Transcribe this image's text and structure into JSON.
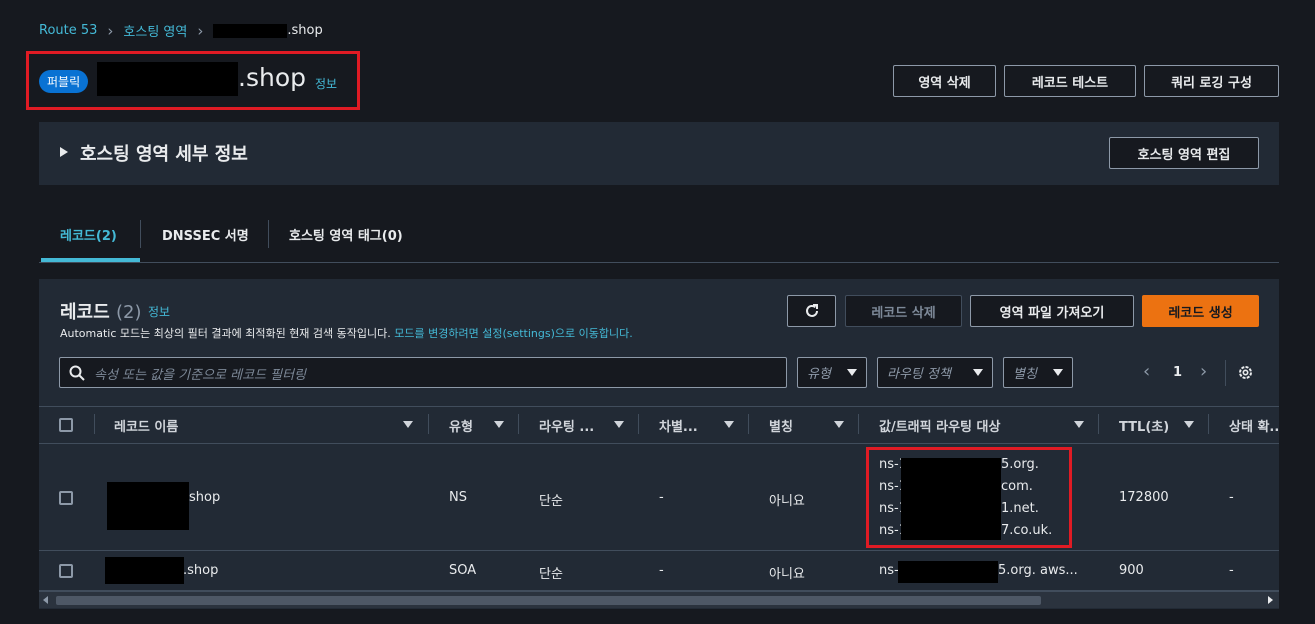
{
  "breadcrumb": {
    "root": "Route 53",
    "hosted_zones": "호스팅 영역",
    "current": ".shop"
  },
  "header": {
    "badge": "퍼블릭",
    "domain_suffix": ".shop",
    "info": "정보"
  },
  "header_buttons": {
    "delete_zone": "영역 삭제",
    "test_record": "레코드 테스트",
    "query_logging": "쿼리 로깅 구성"
  },
  "hosted_zone_details": {
    "title": "호스팅 영역 세부 정보",
    "edit_button": "호스팅 영역 편집"
  },
  "tabs": [
    {
      "label": "레코드(2)"
    },
    {
      "label": "DNSSEC 서명"
    },
    {
      "label": "호스팅 영역 태그(0)"
    }
  ],
  "records": {
    "title": "레코드",
    "count": "(2)",
    "info": "정보",
    "description_prefix": "Automatic 모드는 최상의 필터 결과에 최적화된 현재 검색 동작입니다.",
    "description_link": "모드를 변경하려면 설정(settings)으로 이동합니다.",
    "delete_button": "레코드 삭제",
    "import_button": "영역 파일 가져오기",
    "create_button": "레코드 생성",
    "search_placeholder": "속성 또는 값을 기준으로 레코드 필터링",
    "filters": {
      "type": "유형",
      "routing": "라우팅 정책",
      "alias": "별칭"
    },
    "page": "1"
  },
  "table": {
    "columns": [
      "레코드 이름",
      "유형",
      "라우팅 ...",
      "차별...",
      "별칭",
      "값/트래픽 라우팅 대상",
      "TTL(초)",
      "상태 확..."
    ],
    "rows": [
      {
        "name": "shop",
        "type": "NS",
        "routing": "단순",
        "diff": "-",
        "alias": "아니요",
        "values": [
          "ns-1",
          "5.org.",
          "ns-1",
          "com.",
          "ns-1",
          "1.net.",
          "ns-1",
          "7.co.uk."
        ],
        "ttl": "172800",
        "health": "-"
      },
      {
        "name": ".shop",
        "type": "SOA",
        "routing": "단순",
        "diff": "-",
        "alias": "아니요",
        "value_prefix": "ns-",
        "value_suffix": "5.org. aws...",
        "ttl": "900",
        "health": "-"
      }
    ]
  },
  "colors": {
    "accent": "#44b9d6",
    "primary": "#ec7211",
    "badge": "#0972d3",
    "highlight": "#e01b24"
  }
}
